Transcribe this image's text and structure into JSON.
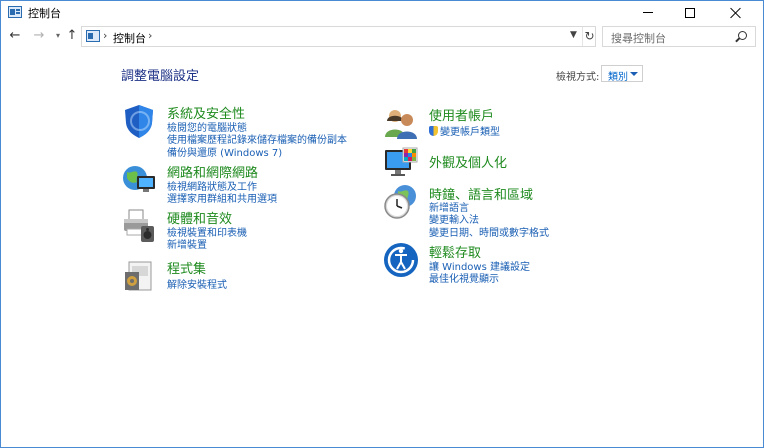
{
  "window": {
    "title": "控制台"
  },
  "address": {
    "crumb": "控制台"
  },
  "search": {
    "placeholder": "搜尋控制台"
  },
  "header": {
    "title": "調整電腦設定",
    "viewby_label": "檢視方式:",
    "viewby_value": "類別"
  },
  "categories": [
    {
      "title": "系統及安全性",
      "icon": "security-shield-icon",
      "links": [
        "檢閱您的電腦狀態",
        "使用檔案歷程記錄來儲存檔案的備份副本",
        "備份與還原 (Windows 7)"
      ]
    },
    {
      "title": "網路和網際網路",
      "icon": "network-globe-icon",
      "links": [
        "檢視網路狀態及工作",
        "選擇家用群組和共用選項"
      ]
    },
    {
      "title": "硬體和音效",
      "icon": "printer-speaker-icon",
      "links": [
        "檢視裝置和印表機",
        "新增裝置"
      ]
    },
    {
      "title": "程式集",
      "icon": "programs-icon",
      "links": [
        "解除安裝程式"
      ]
    },
    {
      "title": "使用者帳戶",
      "icon": "users-icon",
      "links": [
        "變更帳戶類型"
      ]
    },
    {
      "title": "外觀及個人化",
      "icon": "monitor-palette-icon",
      "links": []
    },
    {
      "title": "時鐘、語言和區域",
      "icon": "clock-globe-icon",
      "links": [
        "新增語言",
        "變更輸入法",
        "變更日期、時間或數字格式"
      ]
    },
    {
      "title": "輕鬆存取",
      "icon": "ease-of-access-icon",
      "links": [
        "讓 Windows 建議設定",
        "最佳化視覺顯示"
      ]
    }
  ]
}
